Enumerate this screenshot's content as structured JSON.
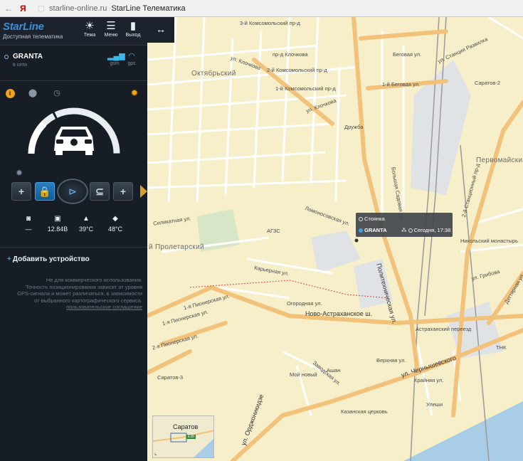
{
  "browser": {
    "nav_glyph": "←",
    "brand_glyph": "Я",
    "url": "starline-online.ru",
    "title": "StarLine Телематика"
  },
  "sidebar": {
    "logo": "StarLine",
    "logo_subtitle": "Доступная телематика",
    "header_buttons": [
      {
        "label": "Тема",
        "icon": "sun-icon"
      },
      {
        "label": "Меню",
        "icon": "menu-icon"
      },
      {
        "label": "Выход",
        "icon": "exit-door-icon"
      }
    ],
    "device": {
      "name": "GRANTA",
      "status": "в сети",
      "gsm_label": "gsm",
      "gps_label": "gps"
    },
    "stats": [
      {
        "icon": "camera-icon",
        "value": "—"
      },
      {
        "icon": "battery-car-icon",
        "value": "12.84В"
      },
      {
        "icon": "car-temperature-icon",
        "value": "39°C"
      },
      {
        "icon": "engine-temperature-icon",
        "value": "48°C"
      }
    ],
    "add_device_label": "Добавить устройство",
    "disclaimer_lines": [
      "Не для коммерческого использования.",
      "Точность позиционирования зависит от уровня",
      "GPS-сигнала и может различаться, в зависимости",
      "от выбранного картографического сервиса."
    ],
    "agreement_link": "пользовательское соглашение"
  },
  "map": {
    "expand_icon": "↔",
    "popup": {
      "state": "Стоянка",
      "device": "GRANTA",
      "time": "Сегодня, 17:38"
    },
    "minimap": {
      "city": "Саратов",
      "road_sign": "Е38"
    },
    "areas": [
      "Октябрьский",
      "Первомайский",
      "й Пролетарский"
    ],
    "streets": [
      "3-й Комсомольский пр-д",
      "ул. Клочкова",
      "пр-д Клочкова",
      "2-й Комсомольский пр-д",
      "1-й Комсомольский пр-д",
      "ул. Клочкова",
      "Беговая ул.",
      "1-й Беговая ул.",
      "Политехническая ул.",
      "Ново-Астраханское ш.",
      "ул. Чернышевского",
      "ул. Орджоникидзе",
      "Огородная ул.",
      "Карьерная ул.",
      "Силикатная ул.",
      "Ломоносовская ул.",
      "2-й Станционный пр-д",
      "Дегтярная ул.",
      "ул. Грибова",
      "ул. Станция Развилка",
      "Верхняя ул.",
      "Заводская ул.",
      "1-я Пионерская ул.",
      "2-я Пионерская ул.",
      "1-я Пионерская ул.",
      "Большая Садовая ул.",
      "Крайняя ул."
    ],
    "pois": [
      "АГЗС",
      "Дружба",
      "Саратов-2",
      "Никольский монастырь",
      "Астраханский переезд",
      "ТНК",
      "Саратов-3",
      "Мой новый",
      "Ашан",
      "Казанская церковь",
      "Улеши"
    ],
    "colors": {
      "background": "#f6efc9",
      "major_road": "#f3c27a",
      "minor_road": "#ffffff",
      "rail": "#9a9a9a",
      "water": "#a9cde6",
      "industrial": "#dfe3e6"
    }
  }
}
